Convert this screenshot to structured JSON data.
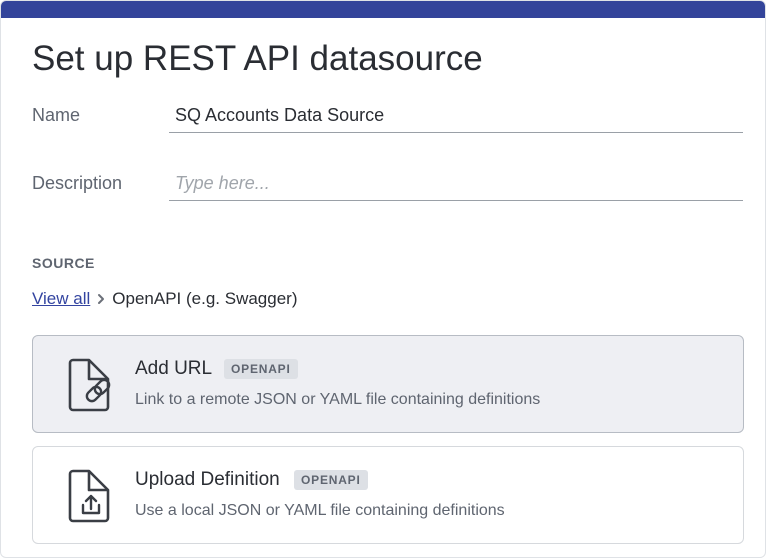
{
  "page": {
    "title": "Set up REST API datasource"
  },
  "form": {
    "name": {
      "label": "Name",
      "value": "SQ Accounts Data Source"
    },
    "description": {
      "label": "Description",
      "placeholder": "Type here...",
      "value": ""
    }
  },
  "source": {
    "section_label": "SOURCE",
    "breadcrumb": {
      "link": "View all",
      "current": "OpenAPI (e.g. Swagger)"
    },
    "options": [
      {
        "title": "Add URL",
        "badge": "OPENAPI",
        "description": "Link to a remote JSON or YAML file containing definitions",
        "icon": "file-link-icon",
        "selected": true
      },
      {
        "title": "Upload Definition",
        "badge": "OPENAPI",
        "description": "Use a local JSON or YAML file containing definitions",
        "icon": "file-upload-icon",
        "selected": false
      }
    ]
  },
  "colors": {
    "accent": "#33449a",
    "link": "#3344a0",
    "selected_card": "#eeeff3"
  }
}
